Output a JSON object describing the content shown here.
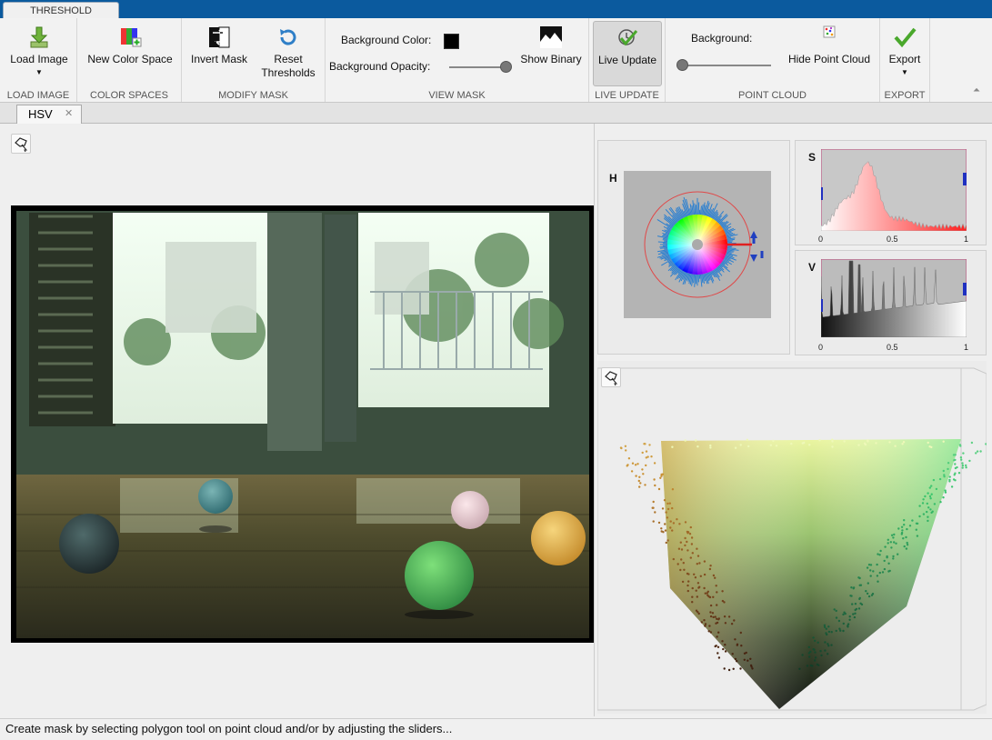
{
  "ribbon_tab": "THRESHOLD",
  "toolstrip": {
    "load_image": "Load Image",
    "new_color_space": "New Color Space",
    "invert_mask": "Invert Mask",
    "reset_thresholds_line1": "Reset",
    "reset_thresholds_line2": "Thresholds",
    "background_color_label": "Background Color:",
    "background_color_value": "#000000",
    "background_opacity_label": "Background Opacity:",
    "background_opacity_value": 1.0,
    "show_binary": "Show Binary",
    "live_update": "Live Update",
    "pc_background_label": "Background:",
    "pc_background_level": 0.0,
    "hide_point_cloud": "Hide Point Cloud",
    "export": "Export"
  },
  "sections": {
    "load_image": "LOAD IMAGE",
    "color_spaces": "COLOR SPACES",
    "modify_mask": "MODIFY MASK",
    "view_mask": "VIEW MASK",
    "live_update": "LIVE UPDATE",
    "point_cloud": "POINT CLOUD",
    "export": "EXPORT"
  },
  "doc_tab": "HSV",
  "histograms": {
    "h_label": "H",
    "s_label": "S",
    "v_label": "V",
    "s_ticks": [
      "0",
      "0.5",
      "1"
    ],
    "v_ticks": [
      "0",
      "0.5",
      "1"
    ]
  },
  "status_text": "Create mask by selecting polygon tool on point cloud and/or by adjusting the sliders..."
}
